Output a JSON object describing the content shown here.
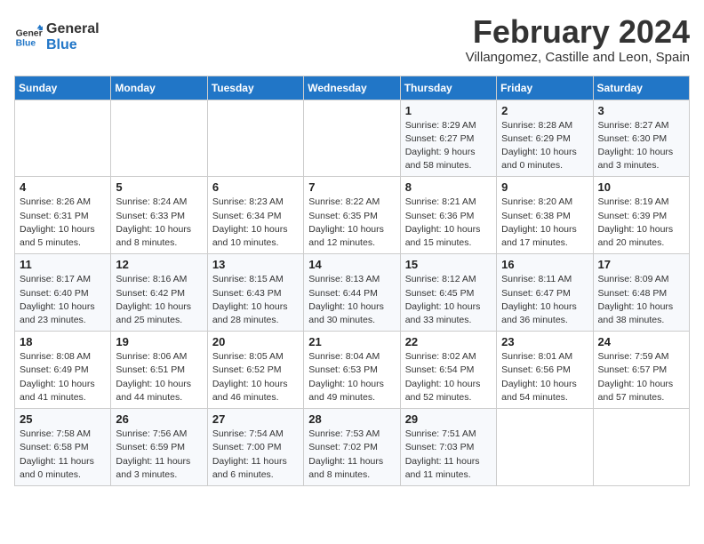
{
  "logo": {
    "line1": "General",
    "line2": "Blue"
  },
  "title": "February 2024",
  "subtitle": "Villangomez, Castille and Leon, Spain",
  "headers": [
    "Sunday",
    "Monday",
    "Tuesday",
    "Wednesday",
    "Thursday",
    "Friday",
    "Saturday"
  ],
  "weeks": [
    [
      {
        "day": "",
        "info": ""
      },
      {
        "day": "",
        "info": ""
      },
      {
        "day": "",
        "info": ""
      },
      {
        "day": "",
        "info": ""
      },
      {
        "day": "1",
        "info": "Sunrise: 8:29 AM\nSunset: 6:27 PM\nDaylight: 9 hours\nand 58 minutes."
      },
      {
        "day": "2",
        "info": "Sunrise: 8:28 AM\nSunset: 6:29 PM\nDaylight: 10 hours\nand 0 minutes."
      },
      {
        "day": "3",
        "info": "Sunrise: 8:27 AM\nSunset: 6:30 PM\nDaylight: 10 hours\nand 3 minutes."
      }
    ],
    [
      {
        "day": "4",
        "info": "Sunrise: 8:26 AM\nSunset: 6:31 PM\nDaylight: 10 hours\nand 5 minutes."
      },
      {
        "day": "5",
        "info": "Sunrise: 8:24 AM\nSunset: 6:33 PM\nDaylight: 10 hours\nand 8 minutes."
      },
      {
        "day": "6",
        "info": "Sunrise: 8:23 AM\nSunset: 6:34 PM\nDaylight: 10 hours\nand 10 minutes."
      },
      {
        "day": "7",
        "info": "Sunrise: 8:22 AM\nSunset: 6:35 PM\nDaylight: 10 hours\nand 12 minutes."
      },
      {
        "day": "8",
        "info": "Sunrise: 8:21 AM\nSunset: 6:36 PM\nDaylight: 10 hours\nand 15 minutes."
      },
      {
        "day": "9",
        "info": "Sunrise: 8:20 AM\nSunset: 6:38 PM\nDaylight: 10 hours\nand 17 minutes."
      },
      {
        "day": "10",
        "info": "Sunrise: 8:19 AM\nSunset: 6:39 PM\nDaylight: 10 hours\nand 20 minutes."
      }
    ],
    [
      {
        "day": "11",
        "info": "Sunrise: 8:17 AM\nSunset: 6:40 PM\nDaylight: 10 hours\nand 23 minutes."
      },
      {
        "day": "12",
        "info": "Sunrise: 8:16 AM\nSunset: 6:42 PM\nDaylight: 10 hours\nand 25 minutes."
      },
      {
        "day": "13",
        "info": "Sunrise: 8:15 AM\nSunset: 6:43 PM\nDaylight: 10 hours\nand 28 minutes."
      },
      {
        "day": "14",
        "info": "Sunrise: 8:13 AM\nSunset: 6:44 PM\nDaylight: 10 hours\nand 30 minutes."
      },
      {
        "day": "15",
        "info": "Sunrise: 8:12 AM\nSunset: 6:45 PM\nDaylight: 10 hours\nand 33 minutes."
      },
      {
        "day": "16",
        "info": "Sunrise: 8:11 AM\nSunset: 6:47 PM\nDaylight: 10 hours\nand 36 minutes."
      },
      {
        "day": "17",
        "info": "Sunrise: 8:09 AM\nSunset: 6:48 PM\nDaylight: 10 hours\nand 38 minutes."
      }
    ],
    [
      {
        "day": "18",
        "info": "Sunrise: 8:08 AM\nSunset: 6:49 PM\nDaylight: 10 hours\nand 41 minutes."
      },
      {
        "day": "19",
        "info": "Sunrise: 8:06 AM\nSunset: 6:51 PM\nDaylight: 10 hours\nand 44 minutes."
      },
      {
        "day": "20",
        "info": "Sunrise: 8:05 AM\nSunset: 6:52 PM\nDaylight: 10 hours\nand 46 minutes."
      },
      {
        "day": "21",
        "info": "Sunrise: 8:04 AM\nSunset: 6:53 PM\nDaylight: 10 hours\nand 49 minutes."
      },
      {
        "day": "22",
        "info": "Sunrise: 8:02 AM\nSunset: 6:54 PM\nDaylight: 10 hours\nand 52 minutes."
      },
      {
        "day": "23",
        "info": "Sunrise: 8:01 AM\nSunset: 6:56 PM\nDaylight: 10 hours\nand 54 minutes."
      },
      {
        "day": "24",
        "info": "Sunrise: 7:59 AM\nSunset: 6:57 PM\nDaylight: 10 hours\nand 57 minutes."
      }
    ],
    [
      {
        "day": "25",
        "info": "Sunrise: 7:58 AM\nSunset: 6:58 PM\nDaylight: 11 hours\nand 0 minutes."
      },
      {
        "day": "26",
        "info": "Sunrise: 7:56 AM\nSunset: 6:59 PM\nDaylight: 11 hours\nand 3 minutes."
      },
      {
        "day": "27",
        "info": "Sunrise: 7:54 AM\nSunset: 7:00 PM\nDaylight: 11 hours\nand 6 minutes."
      },
      {
        "day": "28",
        "info": "Sunrise: 7:53 AM\nSunset: 7:02 PM\nDaylight: 11 hours\nand 8 minutes."
      },
      {
        "day": "29",
        "info": "Sunrise: 7:51 AM\nSunset: 7:03 PM\nDaylight: 11 hours\nand 11 minutes."
      },
      {
        "day": "",
        "info": ""
      },
      {
        "day": "",
        "info": ""
      }
    ]
  ]
}
